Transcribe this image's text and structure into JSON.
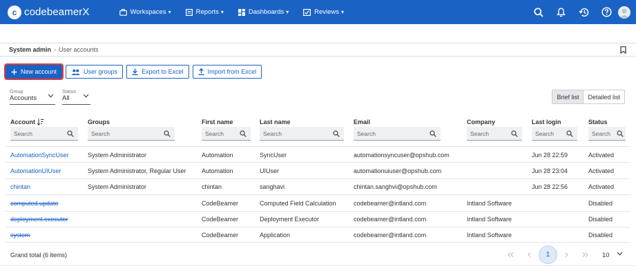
{
  "app": {
    "logo_mark": "c",
    "name": "codebeamerX"
  },
  "nav": [
    {
      "label": "Workspaces",
      "icon": "briefcase-icon"
    },
    {
      "label": "Reports",
      "icon": "report-icon"
    },
    {
      "label": "Dashboards",
      "icon": "dashboard-icon"
    },
    {
      "label": "Reviews",
      "icon": "review-icon"
    }
  ],
  "top_icons": [
    "search-icon",
    "bell-icon",
    "history-icon",
    "help-icon",
    "user-avatar"
  ],
  "breadcrumb": {
    "root": "System admin",
    "separator": "›",
    "current": "User accounts"
  },
  "toolbar": {
    "new_account": "New account",
    "user_groups": "User groups",
    "export_excel": "Export to Excel",
    "import_excel": "Import from Excel"
  },
  "filters": {
    "group": {
      "label": "Group",
      "value": "Accounts"
    },
    "status": {
      "label": "Status",
      "value": "All"
    }
  },
  "view_toggle": {
    "brief": "Brief list",
    "detailed": "Detailed list",
    "active": "brief"
  },
  "table": {
    "columns": {
      "account": "Account",
      "groups": "Groups",
      "first_name": "First name",
      "last_name": "Last name",
      "email": "Email",
      "company": "Company",
      "last_login": "Last login",
      "status": "Status"
    },
    "search_placeholder": "Search",
    "rows": [
      {
        "account": "AutomationSyncUser",
        "groups": "System Administrator",
        "first_name": "Automation",
        "last_name": "SyncUser",
        "email": "automationsyncuser@opshub.com",
        "company": "",
        "last_login": "Jun 28 22:59",
        "status": "Activated"
      },
      {
        "account": "AutomationUIUser",
        "groups": "System Administrator, Regular User",
        "first_name": "Automation",
        "last_name": "UIUser",
        "email": "automationuiuser@opshub.com",
        "company": "",
        "last_login": "Jun 28 23:04",
        "status": "Activated"
      },
      {
        "account": "chintan",
        "groups": "System Administrator",
        "first_name": "chintan",
        "last_name": "sanghavi",
        "email": "chintan.sanghvi@opshub.com",
        "company": "",
        "last_login": "Jun 28 22:56",
        "status": "Activated"
      },
      {
        "account": "computed.update",
        "groups": "",
        "first_name": "CodeBeamer",
        "last_name": "Computed Field Calculation",
        "email": "codebeamer@intland.com",
        "company": "Intland Software",
        "last_login": "",
        "status": "Disabled"
      },
      {
        "account": "deployment.executor",
        "groups": "",
        "first_name": "CodeBeamer",
        "last_name": "Deployment Executor",
        "email": "codebeamer@intland.com",
        "company": "Intland Software",
        "last_login": "",
        "status": "Disabled"
      },
      {
        "account": "system",
        "groups": "",
        "first_name": "CodeBeamer",
        "last_name": "Application",
        "email": "codebeamer@intland.com",
        "company": "Intland Software",
        "last_login": "",
        "status": "Disabled"
      }
    ]
  },
  "footer": {
    "total": "Grand total (6 items)",
    "current_page": "1",
    "page_size": "10"
  },
  "colors": {
    "brand": "#1a63c5",
    "highlight": "#e53935"
  }
}
